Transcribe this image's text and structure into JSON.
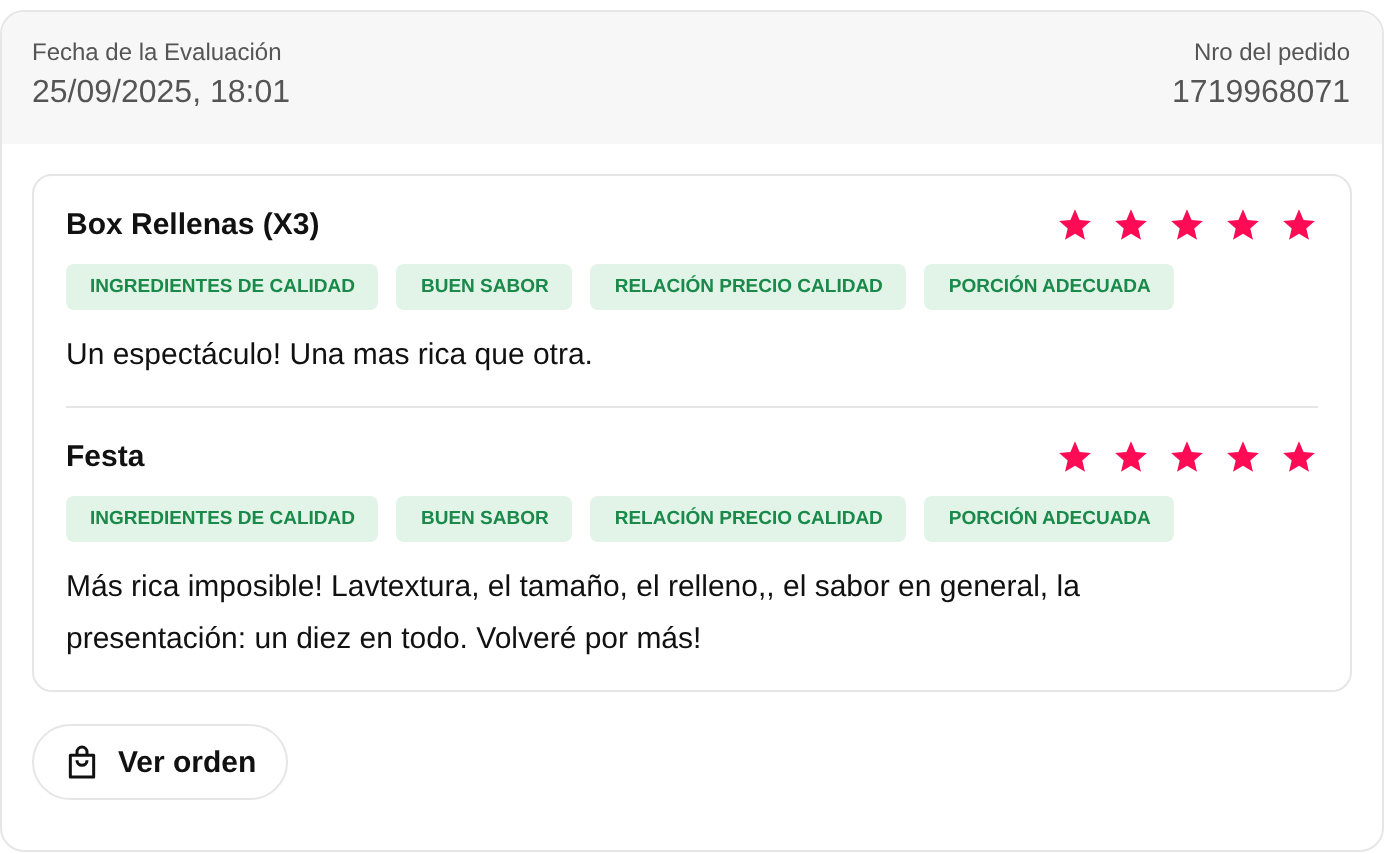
{
  "header": {
    "date_label": "Fecha de la Evaluación",
    "date": "25/09/2025, 18:01",
    "order_label": "Nro del pedido",
    "order_number": "1719968071"
  },
  "products": [
    {
      "name": "Box Rellenas (X3)",
      "stars": 5,
      "tags": [
        "INGREDIENTES DE CALIDAD",
        "BUEN SABOR",
        "RELACIÓN PRECIO CALIDAD",
        "PORCIÓN ADECUADA"
      ],
      "comment": "Un espectáculo! Una mas rica que otra."
    },
    {
      "name": "Festa",
      "stars": 5,
      "tags": [
        "INGREDIENTES DE CALIDAD",
        "BUEN SABOR",
        "RELACIÓN PRECIO CALIDAD",
        "PORCIÓN ADECUADA"
      ],
      "comment": "Más rica imposible! Lavtextura, el tamaño, el relleno,, el sabor en general, la presentación: un diez en todo. Volveré por más!"
    }
  ],
  "button": {
    "label": "Ver orden"
  }
}
